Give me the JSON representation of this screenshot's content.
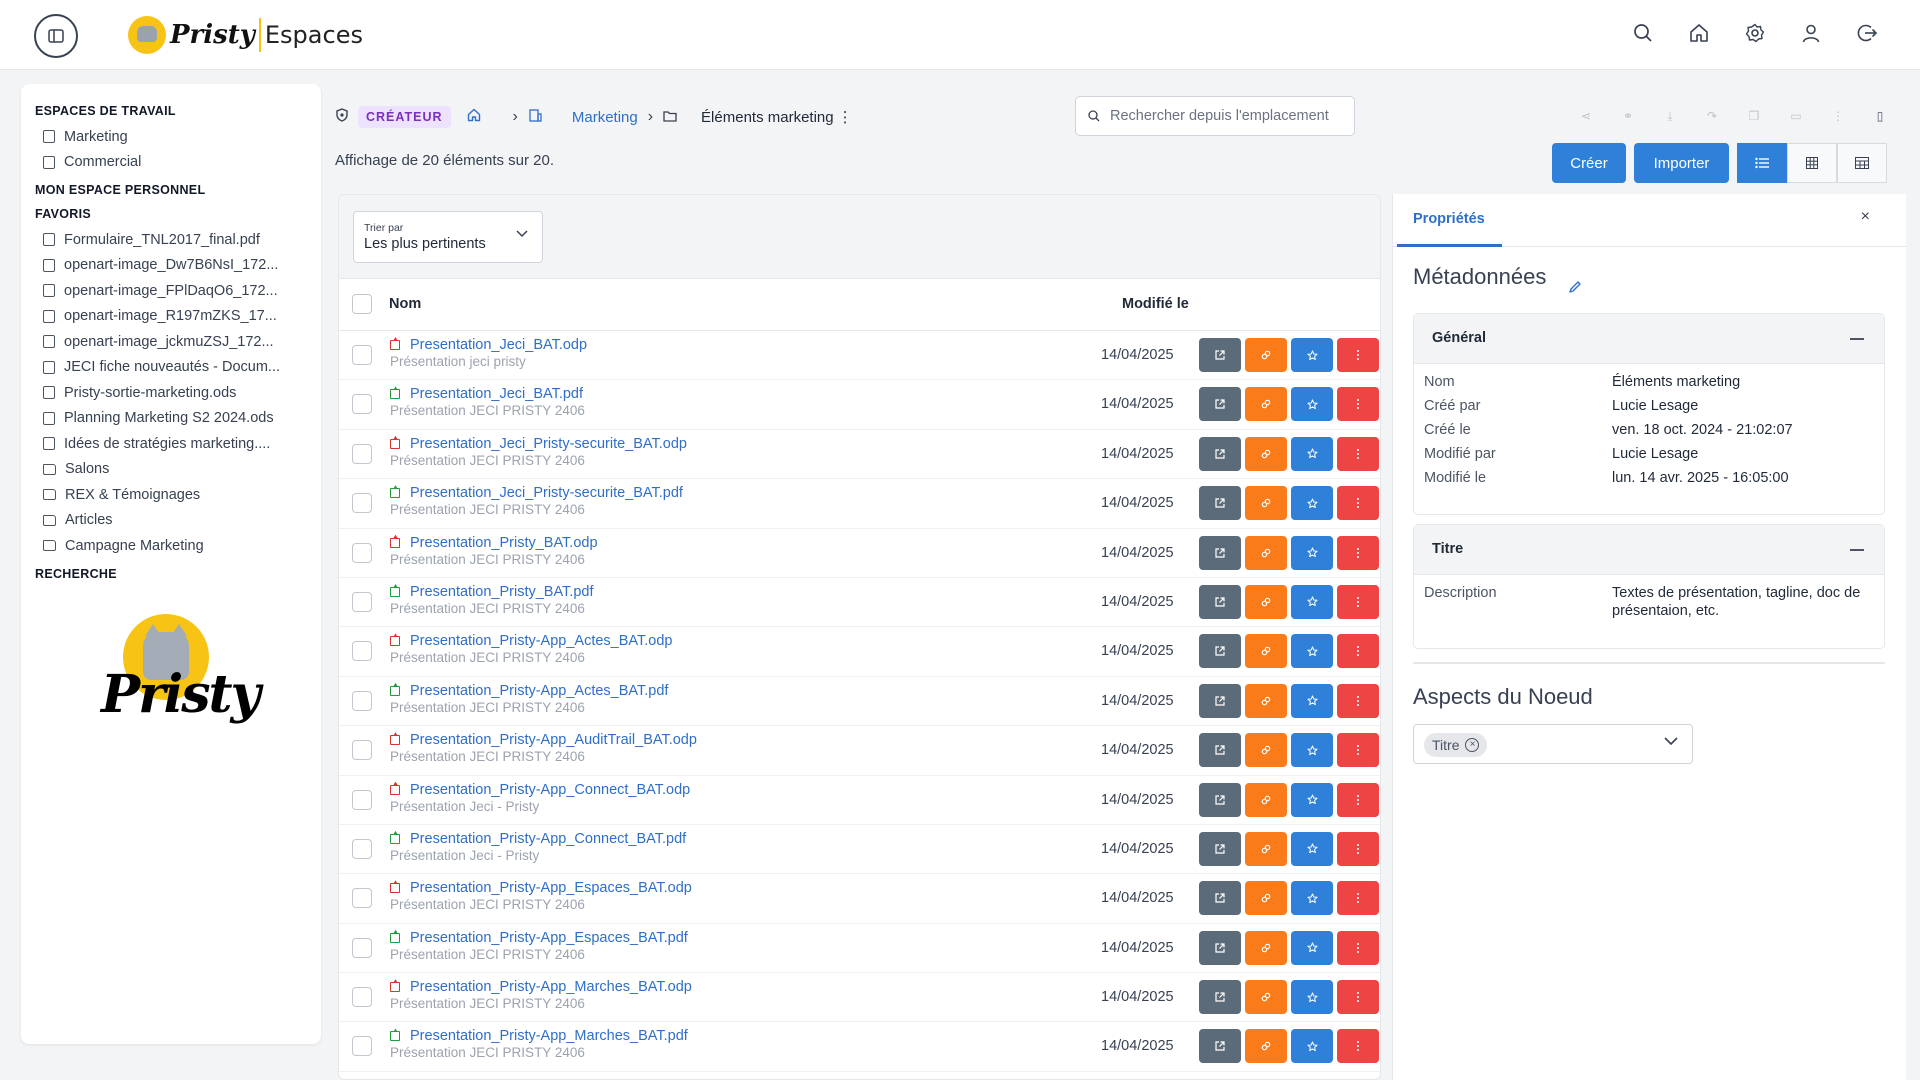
{
  "header": {
    "logo_word": "Pristy",
    "logo_sub": "Espaces",
    "icons": [
      "search-icon",
      "home-icon",
      "gear-icon",
      "user-icon",
      "logout-icon"
    ]
  },
  "sidebar": {
    "workspaces_title": "ESPACES DE TRAVAIL",
    "workspaces": [
      {
        "label": "Marketing",
        "icon": "building-icon"
      },
      {
        "label": "Commercial",
        "icon": "building-icon"
      }
    ],
    "personal_title": "MON ESPACE PERSONNEL",
    "favorites_title": "FAVORIS",
    "favorites": [
      {
        "label": "Formulaire_TNL2017_final.pdf",
        "icon": "file-icon"
      },
      {
        "label": "openart-image_Dw7B6NsI_172...",
        "icon": "file-icon"
      },
      {
        "label": "openart-image_FPlDaqO6_172...",
        "icon": "file-icon"
      },
      {
        "label": "openart-image_R197mZKS_17...",
        "icon": "file-icon"
      },
      {
        "label": "openart-image_jckmuZSJ_172...",
        "icon": "file-icon"
      },
      {
        "label": "JECI fiche nouveautés - Docum...",
        "icon": "file-icon"
      },
      {
        "label": "Pristy-sortie-marketing.ods",
        "icon": "file-icon"
      },
      {
        "label": "Planning Marketing S2 2024.ods",
        "icon": "file-icon"
      },
      {
        "label": "Idées de stratégies marketing....",
        "icon": "file-icon"
      },
      {
        "label": "Salons",
        "icon": "folder-icon"
      },
      {
        "label": "REX & Témoignages",
        "icon": "folder-icon"
      },
      {
        "label": "Articles",
        "icon": "folder-icon"
      },
      {
        "label": "Campagne Marketing",
        "icon": "folder-icon"
      }
    ],
    "search_title": "RECHERCHE",
    "logo_word": "Pristy"
  },
  "breadcrumb": {
    "role_badge": "CRÉATEUR",
    "workspace": "Marketing",
    "current": "Éléments marketing",
    "more": "⋮"
  },
  "search": {
    "placeholder": "Rechercher depuis l'emplacement"
  },
  "count_text": "Affichage de 20 éléments sur 20.",
  "actions": {
    "create": "Créer",
    "import": "Importer",
    "active_view": "list"
  },
  "sort": {
    "label": "Trier par",
    "value": "Les plus pertinents"
  },
  "table": {
    "col_name": "Nom",
    "col_modified": "Modifié le",
    "rows": [
      {
        "name": "Presentation_Jeci_BAT.odp",
        "desc": "Présentation jeci pristy",
        "date": "14/04/2025",
        "type": "odp"
      },
      {
        "name": "Presentation_Jeci_BAT.pdf",
        "desc": "Présentation JECI PRISTY 2406",
        "date": "14/04/2025",
        "type": "pdf"
      },
      {
        "name": "Presentation_Jeci_Pristy-securite_BAT.odp",
        "desc": "Présentation JECI PRISTY 2406",
        "date": "14/04/2025",
        "type": "odp"
      },
      {
        "name": "Presentation_Jeci_Pristy-securite_BAT.pdf",
        "desc": "Présentation JECI PRISTY 2406",
        "date": "14/04/2025",
        "type": "pdf"
      },
      {
        "name": "Presentation_Pristy_BAT.odp",
        "desc": "Présentation JECI PRISTY 2406",
        "date": "14/04/2025",
        "type": "odp"
      },
      {
        "name": "Presentation_Pristy_BAT.pdf",
        "desc": "Présentation JECI PRISTY 2406",
        "date": "14/04/2025",
        "type": "pdf"
      },
      {
        "name": "Presentation_Pristy-App_Actes_BAT.odp",
        "desc": "Présentation JECI PRISTY 2406",
        "date": "14/04/2025",
        "type": "odp"
      },
      {
        "name": "Presentation_Pristy-App_Actes_BAT.pdf",
        "desc": "Présentation JECI PRISTY 2406",
        "date": "14/04/2025",
        "type": "pdf"
      },
      {
        "name": "Presentation_Pristy-App_AuditTrail_BAT.odp",
        "desc": "Présentation JECI PRISTY 2406",
        "date": "14/04/2025",
        "type": "odp"
      },
      {
        "name": "Presentation_Pristy-App_Connect_BAT.odp",
        "desc": "Présentation Jeci - Pristy",
        "date": "14/04/2025",
        "type": "odp"
      },
      {
        "name": "Presentation_Pristy-App_Connect_BAT.pdf",
        "desc": "Présentation Jeci - Pristy",
        "date": "14/04/2025",
        "type": "pdf"
      },
      {
        "name": "Presentation_Pristy-App_Espaces_BAT.odp",
        "desc": "Présentation JECI PRISTY 2406",
        "date": "14/04/2025",
        "type": "odp"
      },
      {
        "name": "Presentation_Pristy-App_Espaces_BAT.pdf",
        "desc": "Présentation JECI PRISTY 2406",
        "date": "14/04/2025",
        "type": "pdf"
      },
      {
        "name": "Presentation_Pristy-App_Marches_BAT.odp",
        "desc": "Présentation JECI PRISTY 2406",
        "date": "14/04/2025",
        "type": "odp"
      },
      {
        "name": "Presentation_Pristy-App_Marches_BAT.pdf",
        "desc": "Présentation JECI PRISTY 2406",
        "date": "14/04/2025",
        "type": "pdf"
      }
    ]
  },
  "properties": {
    "tab": "Propriétés",
    "close": "×",
    "metadata_title": "Métadonnées",
    "general": {
      "title": "Général",
      "fields": [
        {
          "k": "Nom",
          "v": "Éléments marketing"
        },
        {
          "k": "Créé par",
          "v": "Lucie Lesage"
        },
        {
          "k": "Créé le",
          "v": "ven. 18 oct. 2024 - 21:02:07"
        },
        {
          "k": "Modifié par",
          "v": "Lucie Lesage"
        },
        {
          "k": "Modifié le",
          "v": "lun. 14 avr. 2025 - 16:05:00"
        }
      ]
    },
    "titre": {
      "title": "Titre",
      "desc_key": "Description",
      "desc_line1": "Textes de présentation, tagline, doc de",
      "desc_line2": "présentaion, etc."
    },
    "aspects_title": "Aspects du Noeud",
    "aspect_chip": "Titre"
  },
  "colors": {
    "accent": "#2f80d8",
    "link": "#2f6ec9",
    "badge_bg": "#ede2ff",
    "badge_fg": "#7b2fbe",
    "orange": "#f97b1a",
    "red": "#ef4444",
    "gray_btn": "#5c6b7a"
  }
}
